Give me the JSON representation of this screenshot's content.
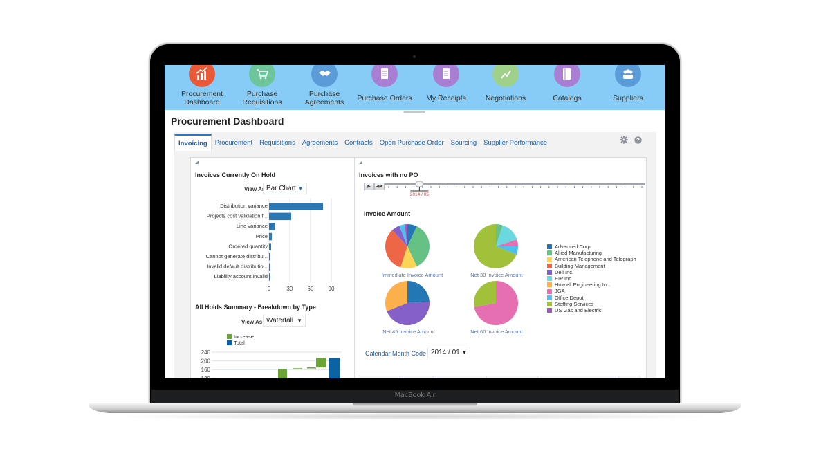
{
  "device": {
    "label": "MacBook Air"
  },
  "nav": {
    "items": [
      {
        "label": "Procurement\nDashboard",
        "line1": "Procurement",
        "line2": "Dashboard",
        "icon": "chart-growth-icon",
        "color": "#ea5a39"
      },
      {
        "label": "Purchase Requisitions",
        "line1": "Purchase",
        "line2": "Requisitions",
        "icon": "shopping-cart-icon",
        "color": "#6cc59b"
      },
      {
        "label": "Purchase Agreements",
        "line1": "Purchase",
        "line2": "Agreements",
        "icon": "handshake-icon",
        "color": "#5b9bd8"
      },
      {
        "label": "Purchase Orders",
        "line1": "Purchase Orders",
        "line2": "",
        "icon": "document-list-icon",
        "color": "#a87fd2"
      },
      {
        "label": "My Receipts",
        "line1": "My Receipts",
        "line2": "",
        "icon": "receipt-icon",
        "color": "#a87fd2"
      },
      {
        "label": "Negotiations",
        "line1": "Negotiations",
        "line2": "",
        "icon": "negotiation-icon",
        "color": "#9fd18a"
      },
      {
        "label": "Catalogs",
        "line1": "Catalogs",
        "line2": "",
        "icon": "catalog-book-icon",
        "color": "#a87fd2"
      },
      {
        "label": "Suppliers",
        "line1": "Suppliers",
        "line2": "",
        "icon": "supplier-group-icon",
        "color": "#5b9bd8"
      }
    ]
  },
  "page": {
    "title": "Procurement Dashboard"
  },
  "tabs": [
    {
      "label": "Invoicing",
      "active": true
    },
    {
      "label": "Procurement"
    },
    {
      "label": "Requisitions"
    },
    {
      "label": "Agreements"
    },
    {
      "label": "Contracts"
    },
    {
      "label": "Open Purchase Order"
    },
    {
      "label": "Sourcing"
    },
    {
      "label": "Supplier Performance"
    }
  ],
  "toolbar": {
    "settings_icon": "gear-icon",
    "help_icon": "help-icon"
  },
  "left_panel": {
    "hold_chart": {
      "title": "Invoices Currently On Hold",
      "view_as_label": "View As",
      "view_as_value": "Bar Chart"
    },
    "summary_chart": {
      "title": "All Holds Summary - Breakdown by Type",
      "view_as_label": "View As",
      "view_as_value": "Waterfall"
    }
  },
  "right_panel": {
    "title": "Invoices with no PO",
    "slider": {
      "value_label": "2014 / 05",
      "play_label": "▶",
      "rewind_label": "◀◀",
      "position_fraction": 0.11
    },
    "pies_title": "Invoice Amount",
    "calendar_label": "Calendar Month Code",
    "calendar_value": "2014 / 01"
  },
  "chart_data": [
    {
      "type": "bar",
      "orientation": "horizontal",
      "title": "Invoices Currently On Hold",
      "categories": [
        "Distribution variance",
        "Projects cost validation f...",
        "Line variance",
        "Price",
        "Ordered quantity",
        "Cannot generate distribu...",
        "Invalid default distributio...",
        "Liability account invalid"
      ],
      "values": [
        78,
        32,
        9,
        4,
        3,
        1,
        1,
        1
      ],
      "xlim": [
        0,
        90
      ],
      "xticks": [
        "0",
        "30",
        "60",
        "90"
      ],
      "color": "#2a77b3",
      "grid": true
    },
    {
      "type": "bar",
      "subtype": "waterfall",
      "title": "All Holds Summary - Breakdown by Type",
      "legend": [
        {
          "name": "Increase",
          "color": "#6aa535"
        },
        {
          "name": "Total",
          "color": "#0b62a4"
        }
      ],
      "yticks": [
        "240",
        "200",
        "160",
        "120"
      ],
      "ylim": [
        120,
        240
      ],
      "visible_steps": [
        {
          "kind": "increase",
          "start": 120,
          "end": 163
        },
        {
          "kind": "increase",
          "start": 163,
          "end": 166
        },
        {
          "kind": "increase",
          "start": 166,
          "end": 170
        },
        {
          "kind": "increase",
          "start": 170,
          "end": 214
        },
        {
          "kind": "total",
          "start": 0,
          "end": 214
        }
      ]
    },
    {
      "type": "pie",
      "title": "Invoice Amount",
      "legend_placement": "right",
      "legend": [
        {
          "name": "Advanced Corp",
          "color": "#2377b4"
        },
        {
          "name": "Allied Manufacturing",
          "color": "#66c185"
        },
        {
          "name": "American Telephone and Telegraph",
          "color": "#fcd556"
        },
        {
          "name": "Building Management",
          "color": "#ed6645"
        },
        {
          "name": "Dell Inc.",
          "color": "#8660c9"
        },
        {
          "name": "EIP Inc",
          "color": "#6ad8de"
        },
        {
          "name": "How ell Engineering Inc.",
          "color": "#fbb04c"
        },
        {
          "name": "JGA",
          "color": "#e56fb0"
        },
        {
          "name": "Office Depot",
          "color": "#4dc0f0"
        },
        {
          "name": "Staffing Services",
          "color": "#a2c13b"
        },
        {
          "name": "US Gas and Electric",
          "color": "#a258c2"
        }
      ],
      "pies": [
        {
          "caption": "Immediate Invoice Amount",
          "slices": [
            {
              "name": "Advanced Corp",
              "value": 7
            },
            {
              "name": "Allied Manufacturing",
              "value": 36
            },
            {
              "name": "American Telephone and Telegraph",
              "value": 12
            },
            {
              "name": "Building Management",
              "value": 33
            },
            {
              "name": "Dell Inc.",
              "value": 6
            },
            {
              "name": "Office Depot",
              "value": 4
            },
            {
              "name": "US Gas and Electric",
              "value": 2
            }
          ]
        },
        {
          "caption": "Net 30 Invoice Amount",
          "slices": [
            {
              "name": "Allied Manufacturing",
              "value": 5
            },
            {
              "name": "EIP Inc",
              "value": 15
            },
            {
              "name": "JGA",
              "value": 5
            },
            {
              "name": "Office Depot",
              "value": 6
            },
            {
              "name": "Staffing Services",
              "value": 69
            }
          ]
        },
        {
          "caption": "Net 45 Invoice Amount",
          "slices": [
            {
              "name": "Advanced Corp",
              "value": 24
            },
            {
              "name": "Dell Inc.",
              "value": 45
            },
            {
              "name": "How ell Engineering Inc.",
              "value": 31
            }
          ]
        },
        {
          "caption": "Net 60 Invoice Amount",
          "slices": [
            {
              "name": "JGA",
              "value": 72
            },
            {
              "name": "Staffing Services",
              "value": 28
            }
          ]
        }
      ]
    }
  ]
}
